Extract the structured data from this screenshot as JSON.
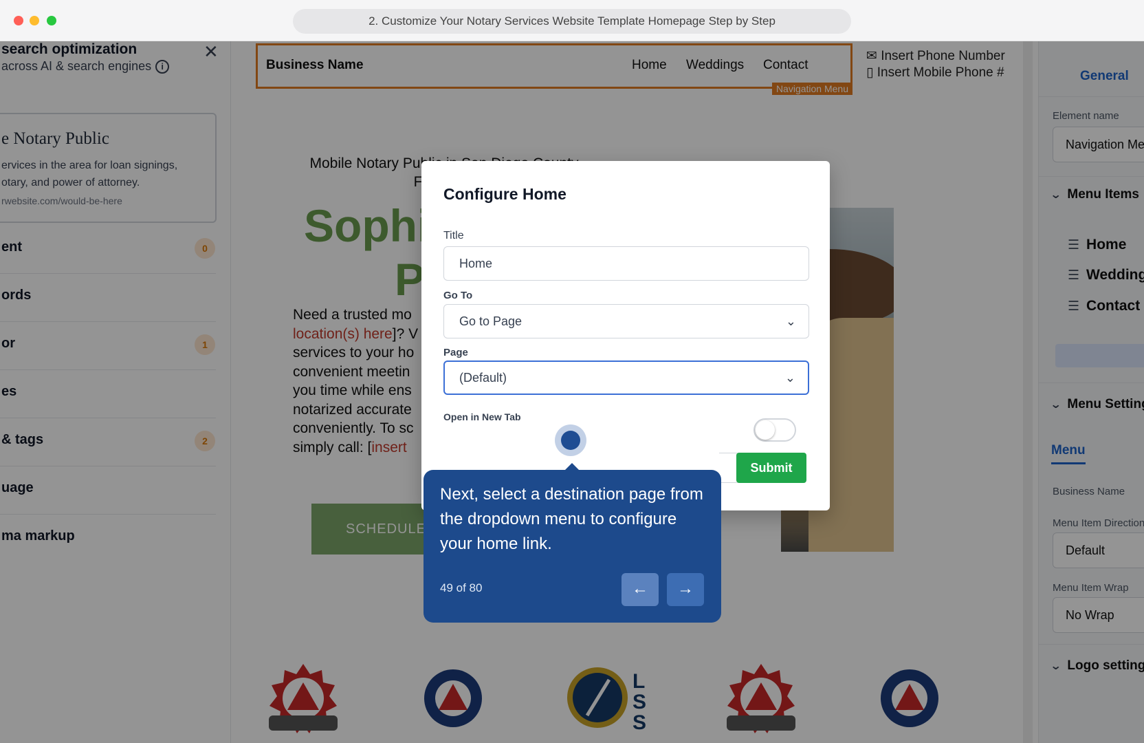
{
  "window": {
    "title": "2. Customize Your Notary Services Website Template Homepage Step by Step"
  },
  "seo_panel": {
    "title": "search optimization",
    "subtitle": "across AI & search engines",
    "preview": {
      "title": "e Notary Public",
      "desc_line1": "ervices in the area for loan signings,",
      "desc_line2": "otary, and power of attorney.",
      "url": "rwebsite.com/would-be-here"
    },
    "rows": [
      {
        "label": "ent",
        "badge": "0"
      },
      {
        "label": "ords",
        "badge": ""
      },
      {
        "label": "or",
        "badge": "1"
      },
      {
        "label": "es",
        "badge": ""
      },
      {
        "label": "& tags",
        "badge": "2"
      },
      {
        "label": "uage",
        "badge": ""
      },
      {
        "label": "ma markup",
        "badge": ""
      }
    ]
  },
  "site": {
    "nav": {
      "business_name": "Business Name",
      "links": [
        "Home",
        "Weddings",
        "Contact"
      ],
      "tag": "Navigation Menu"
    },
    "contact": {
      "phone": "Insert Phone Number",
      "mobile": "Insert Mobile Phone #"
    },
    "hero": {
      "sub_line1": "Mobile Notary Public in San Diego County",
      "sub_line2": "Fast, Reli",
      "name_line1": "Sophi",
      "name_line2": "P",
      "body": [
        {
          "text": "Need a trusted mo",
          "red": ""
        },
        {
          "text": "",
          "red": "location(s) here",
          "tail": "]? V"
        },
        {
          "text": "services to your ho",
          "red": ""
        },
        {
          "text": "convenient meetin",
          "red": ""
        },
        {
          "text": "you time while ens",
          "red": ""
        },
        {
          "text": "notarized accurate",
          "red": ""
        },
        {
          "text": "conveniently. To sc",
          "red": ""
        },
        {
          "text": "simply call: [",
          "red": "insert"
        }
      ],
      "cta": "SCHEDULE"
    }
  },
  "right_panel": {
    "tab": "General",
    "element_name_label": "Element name",
    "element_name_value": "Navigation Menu",
    "menu_items_header": "Menu Items",
    "menu_items": [
      "Home",
      "Weddings",
      "Contact"
    ],
    "menu_settings_header": "Menu Settings",
    "menu_tab": "Menu",
    "business_name_label": "Business Name",
    "direction_label": "Menu Item Direction",
    "direction_value": "Default",
    "wrap_label": "Menu Item Wrap",
    "wrap_value": "No Wrap",
    "logo_header": "Logo settings"
  },
  "modal": {
    "title": "Configure Home",
    "title_label": "Title",
    "title_placeholder": "Home",
    "goto_label": "Go To",
    "goto_value": "Go to Page",
    "page_label": "Page",
    "page_value": "(Default)",
    "new_tab_label": "Open in New Tab",
    "new_tab_on": false,
    "submit": "Submit"
  },
  "tour": {
    "text": "Next, select a destination page from the dropdown menu to configure your home link.",
    "step": "49 of 80"
  },
  "colors": {
    "accent": "#1e63c9",
    "nav_outline": "#e07a22",
    "hero_green": "#6a9c4f",
    "submit_green": "#1fa64a",
    "tooltip_blue": "#1d4a8c"
  }
}
